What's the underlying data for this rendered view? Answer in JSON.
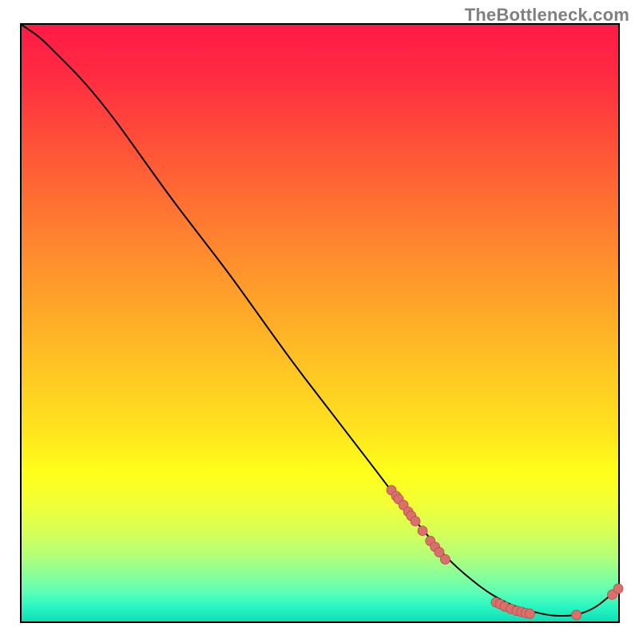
{
  "attribution": "TheBottleneck.com",
  "colors": {
    "curve": "#000000",
    "marker_fill": "#d9706c",
    "marker_stroke": "#b64e4a",
    "frame": "#000000",
    "gradient_top": "#ff1a46",
    "gradient_bottom": "#0fddb7"
  },
  "chart_data": {
    "type": "line",
    "title": "",
    "xlabel": "",
    "ylabel": "",
    "xlim": [
      0,
      100
    ],
    "ylim": [
      0,
      100
    ],
    "grid": false,
    "legend": false,
    "series": [
      {
        "name": "bottleneck-curve",
        "x": [
          0,
          3,
          6,
          10,
          15,
          20,
          25,
          30,
          35,
          40,
          45,
          50,
          55,
          60,
          63,
          65,
          68,
          70,
          73,
          76,
          78,
          80,
          82,
          85,
          88,
          90,
          93,
          96,
          98,
          100
        ],
        "y": [
          100,
          98,
          95,
          91,
          85,
          78,
          71,
          64.5,
          58,
          51,
          44,
          37.5,
          31,
          24.5,
          20.5,
          18,
          14.5,
          12,
          9,
          6.5,
          5,
          3.8,
          2.8,
          1.8,
          1.1,
          0.9,
          1.0,
          2.2,
          3.8,
          5.5
        ]
      }
    ],
    "markers": [
      {
        "x": 62.0,
        "y": 22.0
      },
      {
        "x": 62.8,
        "y": 21.0
      },
      {
        "x": 63.2,
        "y": 20.5
      },
      {
        "x": 64.0,
        "y": 19.5
      },
      {
        "x": 64.8,
        "y": 18.4
      },
      {
        "x": 65.3,
        "y": 17.7
      },
      {
        "x": 66.0,
        "y": 16.8
      },
      {
        "x": 67.2,
        "y": 15.2
      },
      {
        "x": 68.5,
        "y": 13.5
      },
      {
        "x": 69.3,
        "y": 12.5
      },
      {
        "x": 70.0,
        "y": 11.6
      },
      {
        "x": 71.0,
        "y": 10.4
      },
      {
        "x": 79.5,
        "y": 3.2
      },
      {
        "x": 80.2,
        "y": 2.9
      },
      {
        "x": 81.0,
        "y": 2.5
      },
      {
        "x": 82.0,
        "y": 2.1
      },
      {
        "x": 83.0,
        "y": 1.8
      },
      {
        "x": 83.8,
        "y": 1.6
      },
      {
        "x": 84.5,
        "y": 1.4
      },
      {
        "x": 85.2,
        "y": 1.3
      },
      {
        "x": 93.0,
        "y": 1.1
      },
      {
        "x": 99.0,
        "y": 4.5
      },
      {
        "x": 100.0,
        "y": 5.5
      }
    ]
  }
}
